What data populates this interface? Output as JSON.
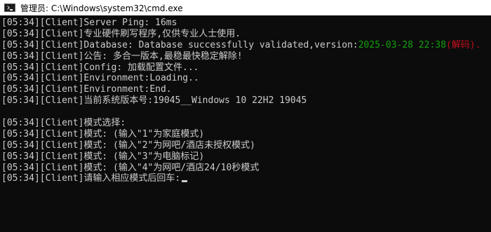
{
  "window": {
    "title": "管理员: C:\\Windows\\system32\\cmd.exe",
    "icon": "cmd-icon"
  },
  "console": {
    "lines": [
      "[05:34][Client]Server Ping: 16ms",
      "[05:34][Client]专业硬件刷写程序,仅供专业人士使用.",
      "[05:34][Client]Database: Database successfully validated,version:",
      "[05:34][Client]公告: 多合一版本,最稳最快稳定解除!",
      "[05:34][Client]Config: 加载配置文件...",
      "[05:34][Client]Environment:Loading..",
      "[05:34][Client]Environment:End.",
      "[05:34][Client]当前系统版本号:19045__Windows 10 22H2 19045",
      "",
      "[05:34][Client]模式选择:",
      "[05:34][Client]模式: (输入\"1\"为家庭模式)",
      "[05:34][Client]模式: (输入\"2\"为网吧/酒店未授权模式)",
      "[05:34][Client]模式: (输入\"3\"为电脑标记)",
      "[05:34][Client]模式: (输入\"4\"为网吧/酒店24/10秒模式",
      "[05:34][Client]请输入相应模式后回车:"
    ],
    "db_version_green": "2025-03-28 22:38",
    "db_version_red": "(解码)."
  },
  "colors": {
    "background": "#0c0c0c",
    "text": "#cccccc",
    "green": "#13a10e",
    "red": "#c50f1f"
  }
}
